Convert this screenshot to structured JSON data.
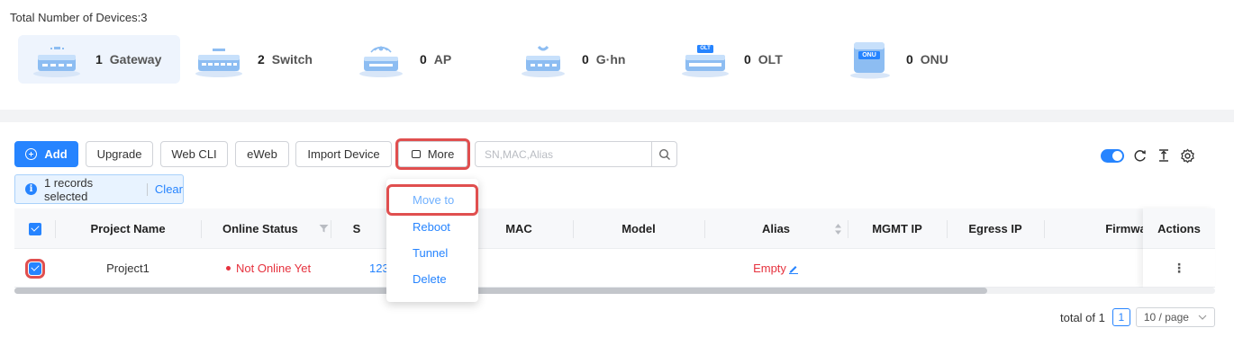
{
  "summary": {
    "title": "Total Number of Devices:3",
    "types": [
      {
        "count": "1",
        "label": "Gateway",
        "icon": "gateway-icon",
        "active": true
      },
      {
        "count": "2",
        "label": "Switch",
        "icon": "switch-icon",
        "active": false
      },
      {
        "count": "0",
        "label": "AP",
        "icon": "ap-icon",
        "active": false
      },
      {
        "count": "0",
        "label": "G·hn",
        "icon": "ghn-icon",
        "active": false
      },
      {
        "count": "0",
        "label": "OLT",
        "icon": "olt-icon",
        "active": false
      },
      {
        "count": "0",
        "label": "ONU",
        "icon": "onu-icon",
        "active": false
      }
    ],
    "icon_badges": {
      "olt": "OLT",
      "onu": "ONU"
    }
  },
  "toolbar": {
    "add_label": "Add",
    "upgrade_label": "Upgrade",
    "webcli_label": "Web CLI",
    "eweb_label": "eWeb",
    "import_label": "Import Device",
    "more_label": "More",
    "search_placeholder": "SN,MAC,Alias"
  },
  "selection": {
    "text": "1 records selected",
    "clear_label": "Clear",
    "info_glyph": "i"
  },
  "more_menu": {
    "items": [
      "Move to",
      "Reboot",
      "Tunnel",
      "Delete"
    ]
  },
  "table": {
    "columns": [
      "Project Name",
      "Online Status",
      "S",
      "MAC",
      "Model",
      "Alias",
      "MGMT IP",
      "Egress IP",
      "Firmware",
      "Actions"
    ],
    "rows": [
      {
        "project": "Project1",
        "status": "Not Online Yet",
        "sn": "123",
        "alias": "Empty",
        "actions": "⋮"
      }
    ]
  },
  "pagination": {
    "total": "total of 1",
    "current": "1",
    "page_size": "10 / page"
  },
  "colors": {
    "accent": "#2684ff",
    "status_offline": "#e6323e",
    "highlight_outline": "#e04f4f"
  }
}
